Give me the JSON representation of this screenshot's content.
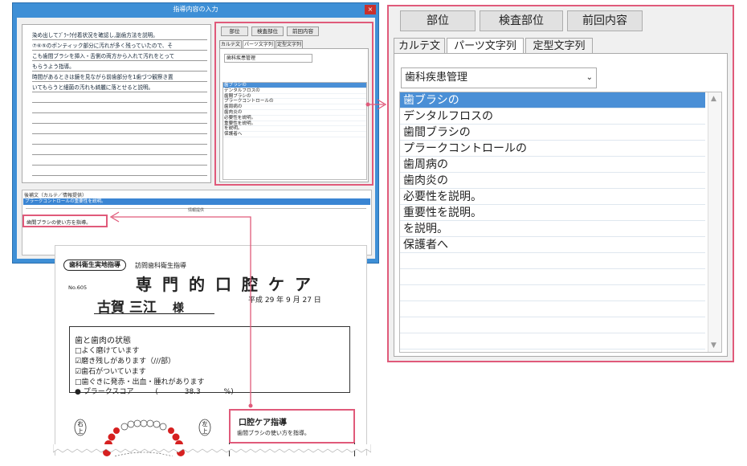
{
  "dialog": {
    "title": "指導内容の入力",
    "close_glyph": "×",
    "memo_lines": [
      "染め出してﾌﾞﾗｰｸ付着状況を確認し,副歯方法を説明。",
      "⑦⑥⑤のポンティック部分に汚れが多く残っていたので、そ",
      "こも歯間ブラシを挿入・舌側の両方から入れて汚れをとって",
      "もらうよう指導。",
      "時間があるときは鏡を見ながら前歯部分を1歯づつ観察き置",
      "いてもらうと細菌の汚れも綺麗に落とせると説明。"
    ],
    "small_buttons": [
      "部位",
      "検査部位",
      "前回内容"
    ],
    "small_tabs": [
      "カルテ文",
      "パーツ文字列",
      "定型文字列"
    ],
    "small_dropdown": "歯科疾患管理",
    "small_items": [
      "歯ブラシの",
      "デンタルフロスの",
      "歯間ブラシの",
      "プラークコントロールの",
      "歯周病の",
      "歯肉炎の",
      "必要性を説明。",
      "重要性を説明。",
      "を説明。",
      "保護者へ"
    ],
    "supp_header": "後補文（カルテ／情報提供）",
    "supp_selected": "プラークコントロールの重要性を説明。",
    "supp_divider": "情報提供",
    "supp_text": "歯間ブラシの使い方を指導。"
  },
  "panel": {
    "buttons": [
      "部位",
      "検査部位",
      "前回内容"
    ],
    "tabs": [
      "カルテ文",
      "パーツ文字列",
      "定型文字列"
    ],
    "dropdown": "歯科疾患管理",
    "items": [
      "歯ブラシの",
      "デンタルフロスの",
      "歯間ブラシの",
      "プラークコントロールの",
      "歯周病の",
      "歯肉炎の",
      "必要性を説明。",
      "重要性を説明。",
      "を説明。",
      "保護者へ"
    ],
    "selected_index": 0
  },
  "paper": {
    "oval_label": "歯科衛生実地指導",
    "subtitle": "訪問歯科衛生指導",
    "title": "専門的口腔ケア",
    "number": "No.605",
    "patient_name": "古賀 三江",
    "honorific": "様",
    "date": "平成 29 年  9 月 27 日",
    "status_heading": "歯と歯肉の状態",
    "status_lines": [
      "□よく磨けています",
      "☑磨き残しがあります（///部）",
      "☑歯石がついています",
      "□歯ぐきに発赤・出血・腫れがあります"
    ],
    "plaque_label": "● プラークスコア",
    "plaque_score": "38.3",
    "plaque_unit": "%)",
    "plaque_open": "(",
    "care_title": "口腔ケア指導",
    "care_text": "歯間ブラシの使い方を指導。",
    "right_label": "右上",
    "left_label": "左上"
  },
  "colors": {
    "accent": "#e05a7a",
    "selection": "#4a8fd6",
    "dialog_frame": "#3e8fd6"
  }
}
